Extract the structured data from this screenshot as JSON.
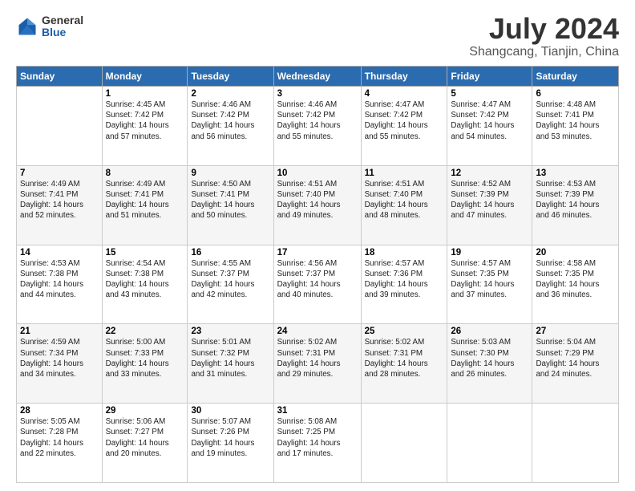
{
  "header": {
    "logo": {
      "general": "General",
      "blue": "Blue"
    },
    "title": "July 2024",
    "subtitle": "Shangcang, Tianjin, China"
  },
  "days_of_week": [
    "Sunday",
    "Monday",
    "Tuesday",
    "Wednesday",
    "Thursday",
    "Friday",
    "Saturday"
  ],
  "weeks": [
    [
      {
        "day": "",
        "info": ""
      },
      {
        "day": "1",
        "info": "Sunrise: 4:45 AM\nSunset: 7:42 PM\nDaylight: 14 hours\nand 57 minutes."
      },
      {
        "day": "2",
        "info": "Sunrise: 4:46 AM\nSunset: 7:42 PM\nDaylight: 14 hours\nand 56 minutes."
      },
      {
        "day": "3",
        "info": "Sunrise: 4:46 AM\nSunset: 7:42 PM\nDaylight: 14 hours\nand 55 minutes."
      },
      {
        "day": "4",
        "info": "Sunrise: 4:47 AM\nSunset: 7:42 PM\nDaylight: 14 hours\nand 55 minutes."
      },
      {
        "day": "5",
        "info": "Sunrise: 4:47 AM\nSunset: 7:42 PM\nDaylight: 14 hours\nand 54 minutes."
      },
      {
        "day": "6",
        "info": "Sunrise: 4:48 AM\nSunset: 7:41 PM\nDaylight: 14 hours\nand 53 minutes."
      }
    ],
    [
      {
        "day": "7",
        "info": "Sunrise: 4:49 AM\nSunset: 7:41 PM\nDaylight: 14 hours\nand 52 minutes."
      },
      {
        "day": "8",
        "info": "Sunrise: 4:49 AM\nSunset: 7:41 PM\nDaylight: 14 hours\nand 51 minutes."
      },
      {
        "day": "9",
        "info": "Sunrise: 4:50 AM\nSunset: 7:41 PM\nDaylight: 14 hours\nand 50 minutes."
      },
      {
        "day": "10",
        "info": "Sunrise: 4:51 AM\nSunset: 7:40 PM\nDaylight: 14 hours\nand 49 minutes."
      },
      {
        "day": "11",
        "info": "Sunrise: 4:51 AM\nSunset: 7:40 PM\nDaylight: 14 hours\nand 48 minutes."
      },
      {
        "day": "12",
        "info": "Sunrise: 4:52 AM\nSunset: 7:39 PM\nDaylight: 14 hours\nand 47 minutes."
      },
      {
        "day": "13",
        "info": "Sunrise: 4:53 AM\nSunset: 7:39 PM\nDaylight: 14 hours\nand 46 minutes."
      }
    ],
    [
      {
        "day": "14",
        "info": "Sunrise: 4:53 AM\nSunset: 7:38 PM\nDaylight: 14 hours\nand 44 minutes."
      },
      {
        "day": "15",
        "info": "Sunrise: 4:54 AM\nSunset: 7:38 PM\nDaylight: 14 hours\nand 43 minutes."
      },
      {
        "day": "16",
        "info": "Sunrise: 4:55 AM\nSunset: 7:37 PM\nDaylight: 14 hours\nand 42 minutes."
      },
      {
        "day": "17",
        "info": "Sunrise: 4:56 AM\nSunset: 7:37 PM\nDaylight: 14 hours\nand 40 minutes."
      },
      {
        "day": "18",
        "info": "Sunrise: 4:57 AM\nSunset: 7:36 PM\nDaylight: 14 hours\nand 39 minutes."
      },
      {
        "day": "19",
        "info": "Sunrise: 4:57 AM\nSunset: 7:35 PM\nDaylight: 14 hours\nand 37 minutes."
      },
      {
        "day": "20",
        "info": "Sunrise: 4:58 AM\nSunset: 7:35 PM\nDaylight: 14 hours\nand 36 minutes."
      }
    ],
    [
      {
        "day": "21",
        "info": "Sunrise: 4:59 AM\nSunset: 7:34 PM\nDaylight: 14 hours\nand 34 minutes."
      },
      {
        "day": "22",
        "info": "Sunrise: 5:00 AM\nSunset: 7:33 PM\nDaylight: 14 hours\nand 33 minutes."
      },
      {
        "day": "23",
        "info": "Sunrise: 5:01 AM\nSunset: 7:32 PM\nDaylight: 14 hours\nand 31 minutes."
      },
      {
        "day": "24",
        "info": "Sunrise: 5:02 AM\nSunset: 7:31 PM\nDaylight: 14 hours\nand 29 minutes."
      },
      {
        "day": "25",
        "info": "Sunrise: 5:02 AM\nSunset: 7:31 PM\nDaylight: 14 hours\nand 28 minutes."
      },
      {
        "day": "26",
        "info": "Sunrise: 5:03 AM\nSunset: 7:30 PM\nDaylight: 14 hours\nand 26 minutes."
      },
      {
        "day": "27",
        "info": "Sunrise: 5:04 AM\nSunset: 7:29 PM\nDaylight: 14 hours\nand 24 minutes."
      }
    ],
    [
      {
        "day": "28",
        "info": "Sunrise: 5:05 AM\nSunset: 7:28 PM\nDaylight: 14 hours\nand 22 minutes."
      },
      {
        "day": "29",
        "info": "Sunrise: 5:06 AM\nSunset: 7:27 PM\nDaylight: 14 hours\nand 20 minutes."
      },
      {
        "day": "30",
        "info": "Sunrise: 5:07 AM\nSunset: 7:26 PM\nDaylight: 14 hours\nand 19 minutes."
      },
      {
        "day": "31",
        "info": "Sunrise: 5:08 AM\nSunset: 7:25 PM\nDaylight: 14 hours\nand 17 minutes."
      },
      {
        "day": "",
        "info": ""
      },
      {
        "day": "",
        "info": ""
      },
      {
        "day": "",
        "info": ""
      }
    ]
  ]
}
